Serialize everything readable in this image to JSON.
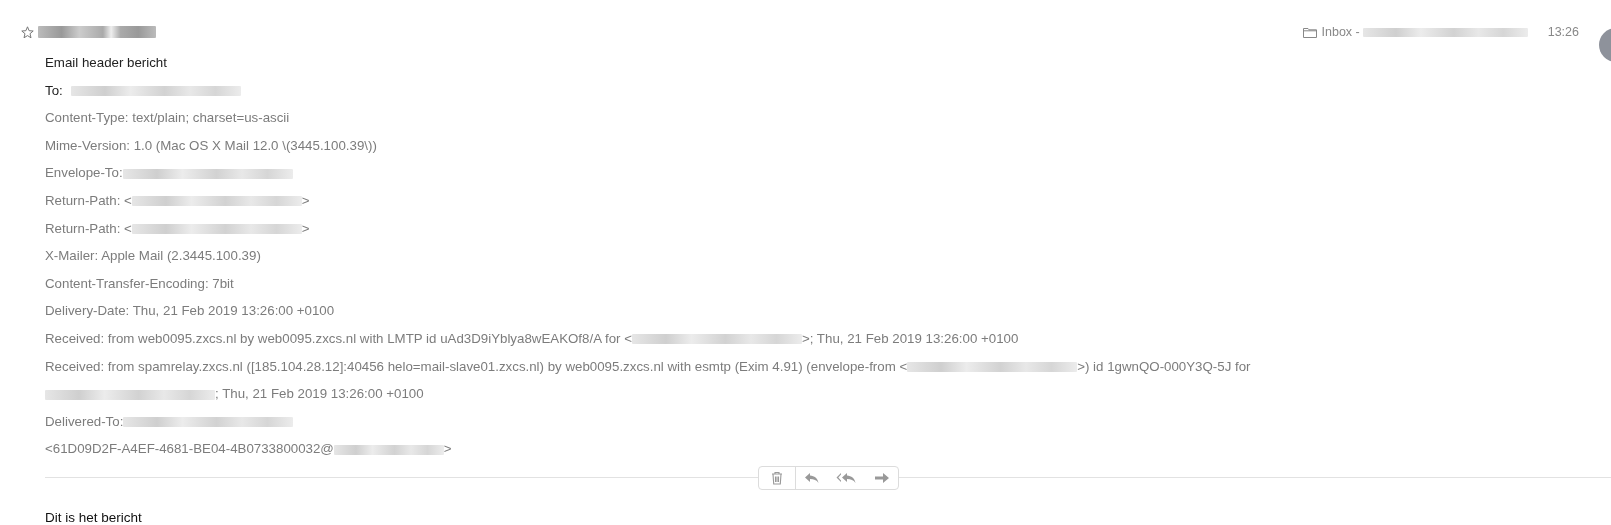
{
  "message": {
    "starred": false,
    "sender": {
      "redacted": true
    },
    "mailbox": {
      "label": "Inbox -",
      "account_redacted": true
    },
    "time": "13:26",
    "lines": [
      {
        "kind": "subject",
        "parts": [
          {
            "kind": "text",
            "text": "Email header bericht"
          }
        ]
      },
      {
        "kind": "to",
        "parts": [
          {
            "kind": "text",
            "text": "To:"
          },
          {
            "kind": "redacted"
          }
        ]
      },
      {
        "kind": "header",
        "parts": [
          {
            "kind": "text",
            "text": "Content-Type: text/plain; charset=us-ascii"
          }
        ]
      },
      {
        "kind": "header",
        "parts": [
          {
            "kind": "text",
            "text": "Mime-Version: 1.0 (Mac OS X Mail 12.0 \\(3445.100.39\\))"
          }
        ]
      },
      {
        "kind": "header",
        "parts": [
          {
            "kind": "text",
            "text": "Envelope-To:"
          },
          {
            "kind": "redacted"
          }
        ]
      },
      {
        "kind": "header",
        "parts": [
          {
            "kind": "text",
            "text": "Return-Path: <"
          },
          {
            "kind": "redacted"
          },
          {
            "kind": "text",
            "text": ">"
          }
        ]
      },
      {
        "kind": "header",
        "parts": [
          {
            "kind": "text",
            "text": "Return-Path: <"
          },
          {
            "kind": "redacted"
          },
          {
            "kind": "text",
            "text": ">"
          }
        ]
      },
      {
        "kind": "header",
        "parts": [
          {
            "kind": "text",
            "text": "X-Mailer: Apple Mail (2.3445.100.39)"
          }
        ]
      },
      {
        "kind": "header",
        "parts": [
          {
            "kind": "text",
            "text": "Content-Transfer-Encoding: 7bit"
          }
        ]
      },
      {
        "kind": "header",
        "parts": [
          {
            "kind": "text",
            "text": "Delivery-Date: Thu, 21 Feb 2019 13:26:00 +0100"
          }
        ]
      },
      {
        "kind": "header",
        "parts": [
          {
            "kind": "text",
            "text": "Received: from web0095.zxcs.nl by web0095.zxcs.nl with LMTP id uAd3D9iYblya8wEAKOf8/A for <"
          },
          {
            "kind": "redacted"
          },
          {
            "kind": "text",
            "text": ">; Thu, 21 Feb 2019 13:26:00 +0100"
          }
        ]
      },
      {
        "kind": "header",
        "parts": [
          {
            "kind": "text",
            "text": "Received: from spamrelay.zxcs.nl ([185.104.28.12]:40456 helo=mail-slave01.zxcs.nl) by web0095.zxcs.nl with esmtp (Exim 4.91) (envelope-from <"
          },
          {
            "kind": "redacted"
          },
          {
            "kind": "text",
            "text": ">) id 1gwnQO-000Y3Q-5J for"
          },
          {
            "kind": "break"
          },
          {
            "kind": "redacted"
          },
          {
            "kind": "text",
            "text": "; Thu, 21 Feb 2019 13:26:00 +0100"
          }
        ]
      },
      {
        "kind": "header",
        "parts": [
          {
            "kind": "text",
            "text": "Delivered-To:"
          },
          {
            "kind": "redacted"
          }
        ]
      },
      {
        "kind": "header",
        "parts": [
          {
            "kind": "text",
            "text": "<61D09D2F-A4EF-4681-BE04-4B0733800032@"
          },
          {
            "kind": "redacted"
          },
          {
            "kind": "text",
            "text": ">"
          }
        ]
      }
    ],
    "body": "Dit is het bericht"
  }
}
